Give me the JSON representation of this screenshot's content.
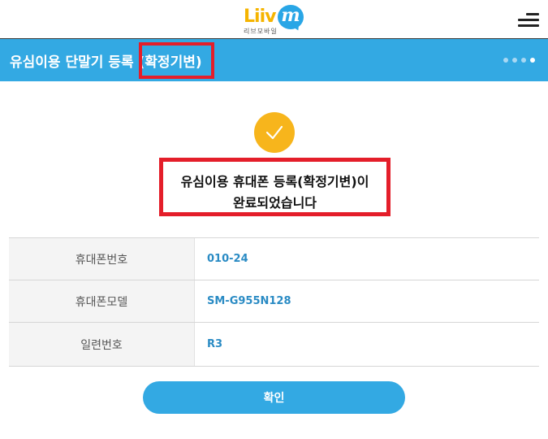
{
  "header": {
    "logo_word_part1": "Li",
    "logo_word_part2": "iv",
    "logo_letter": "m",
    "logo_subtitle": "리브모바일",
    "menu_icon": "hamburger-menu-icon"
  },
  "titlebar": {
    "title": "유심이용 단말기 등록 (확정기변)",
    "step_dots": 4,
    "active_step": 4
  },
  "result": {
    "icon": "check-icon",
    "line1": "유심이용 휴대폰 등록(확정기변)이",
    "line2": "완료되었습니다"
  },
  "info": {
    "rows": [
      {
        "label": "휴대폰번호",
        "value": "010-24"
      },
      {
        "label": "휴대폰모델",
        "value": "SM-G955N128"
      },
      {
        "label": "일련번호",
        "value": "R3"
      }
    ]
  },
  "actions": {
    "confirm_label": "확인"
  },
  "colors": {
    "primary": "#33a9e3",
    "check": "#f7b51c",
    "highlight": "#e41e2a",
    "value_text": "#2a8bc4"
  }
}
